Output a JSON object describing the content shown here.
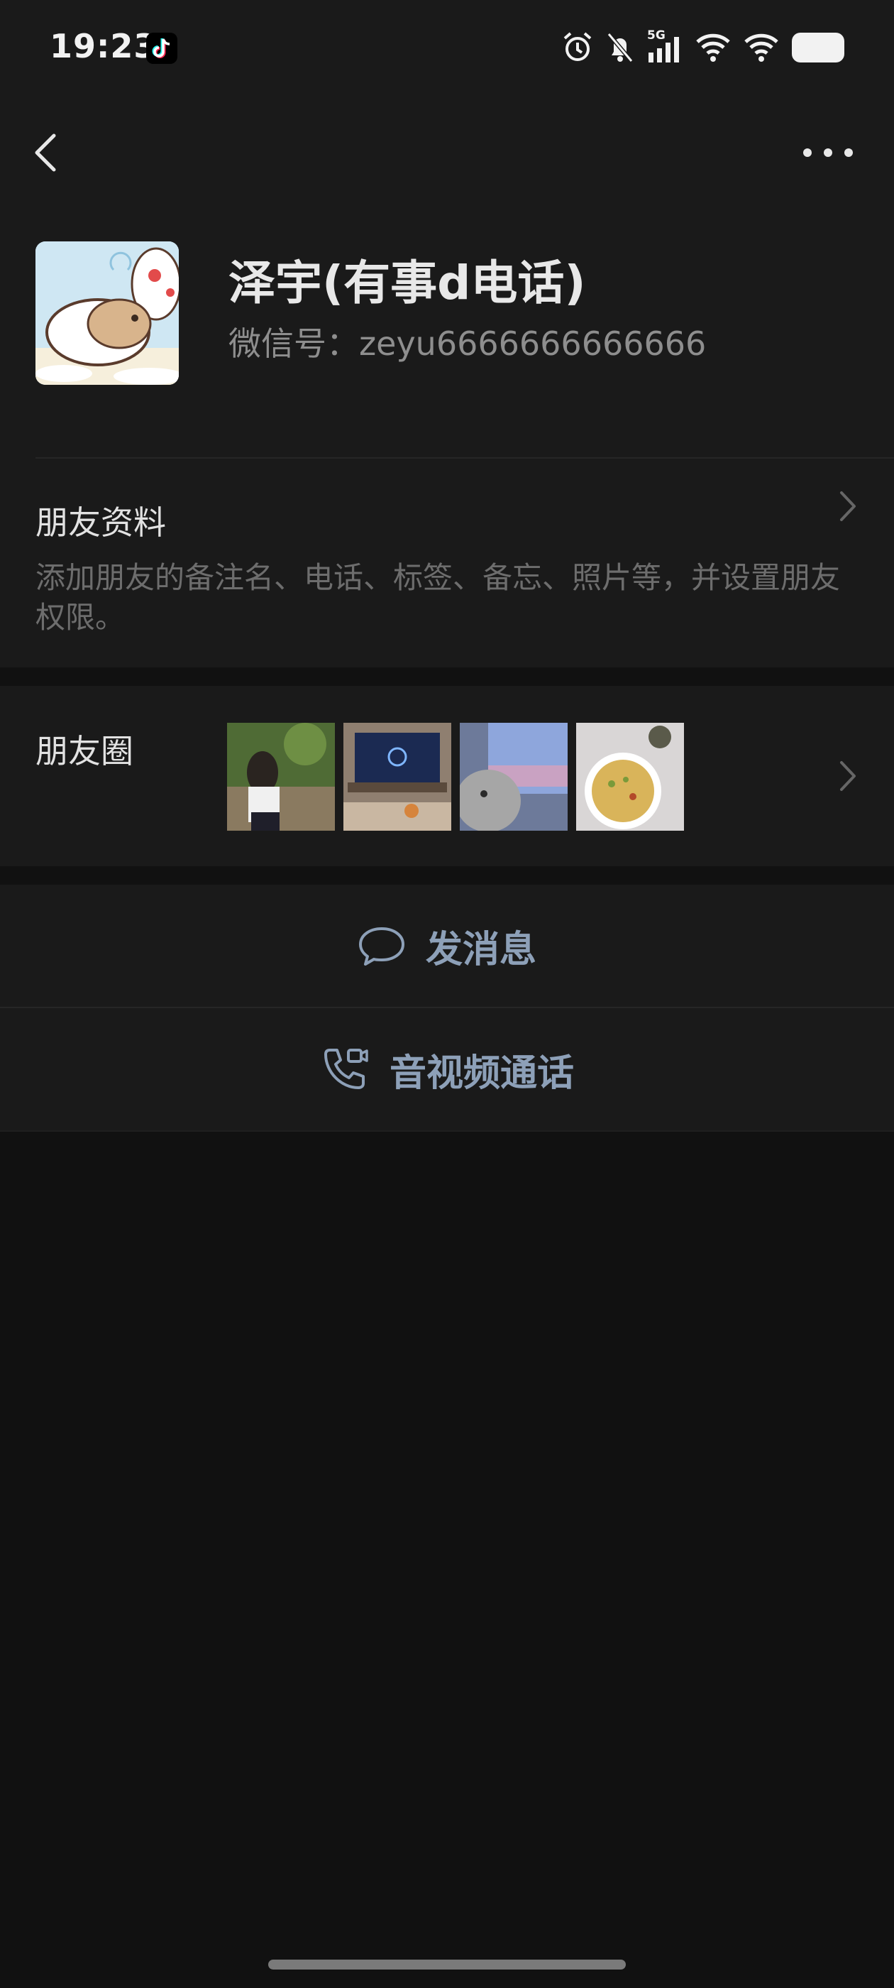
{
  "status_bar": {
    "time": "19:23",
    "network": "5G",
    "icons": [
      "tiktok-icon",
      "alarm-icon",
      "bell-off-icon",
      "signal-icon",
      "wifi-icon",
      "wifi-icon",
      "battery-icon"
    ]
  },
  "header": {
    "back_icon": "chevron-left-icon",
    "more_icon": "more-dots-icon"
  },
  "profile": {
    "name": "泽宇(有事d电话)",
    "wechat_id": "微信号：zeyu6666666666666"
  },
  "friend_info": {
    "title": "朋友资料",
    "description": "添加朋友的备注名、电话、标签、备忘、照片等，并设置朋友权限。"
  },
  "moments": {
    "title": "朋友圈",
    "thumbnails": [
      "photo-girl-garden",
      "photo-tv-room",
      "photo-cat-screen",
      "photo-pizza"
    ]
  },
  "actions": {
    "message_label": "发消息",
    "call_label": "音视频通话"
  },
  "colors": {
    "background": "#111111",
    "section_bg": "#1a1a1a",
    "action_text": "#8da0b8"
  }
}
